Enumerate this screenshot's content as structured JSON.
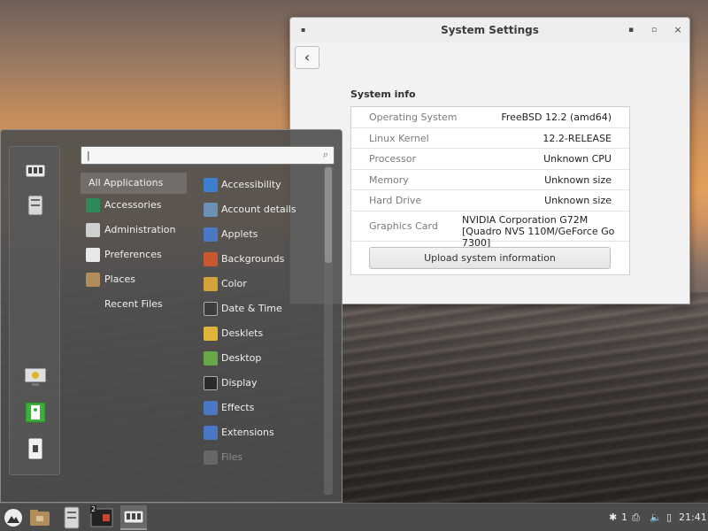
{
  "settings_window": {
    "title": "System Settings",
    "back_glyph": "‹",
    "min_glyph": "▪",
    "max_glyph": "▫",
    "close_glyph": "×",
    "menu_glyph": "▪",
    "section_title": "System info",
    "rows": [
      {
        "key": "Operating System",
        "value": "FreeBSD 12.2 (amd64)"
      },
      {
        "key": "Linux Kernel",
        "value": "12.2-RELEASE"
      },
      {
        "key": "Processor",
        "value": "Unknown CPU"
      },
      {
        "key": "Memory",
        "value": "Unknown size"
      },
      {
        "key": "Hard Drive",
        "value": "Unknown size"
      },
      {
        "key": "Graphics Card",
        "value": "NVIDIA Corporation G72M [Quadro NVS 110M/GeForce Go 7300]"
      }
    ],
    "upload_label": "Upload system information"
  },
  "menu": {
    "search": {
      "value": "|",
      "icon": "search-icon"
    },
    "categories": [
      {
        "label": "All Applications",
        "icon": "none",
        "selected": true
      },
      {
        "label": "Accessories",
        "icon": "accessories-icon"
      },
      {
        "label": "Administration",
        "icon": "administration-icon"
      },
      {
        "label": "Preferences",
        "icon": "preferences-icon"
      },
      {
        "label": "Places",
        "icon": "folder-icon"
      },
      {
        "label": "Recent Files",
        "icon": "none"
      }
    ],
    "apps": [
      {
        "label": "Accessibility",
        "icon": "accessibility-icon",
        "color": "#3a7fd0"
      },
      {
        "label": "Account details",
        "icon": "account-icon",
        "color": "#6d8fb5"
      },
      {
        "label": "Applets",
        "icon": "applets-icon",
        "color": "#4a78c4"
      },
      {
        "label": "Backgrounds",
        "icon": "backgrounds-icon",
        "color": "#c9562f"
      },
      {
        "label": "Color",
        "icon": "color-icon",
        "color": "#d4a23a"
      },
      {
        "label": "Date & Time",
        "icon": "clock-icon",
        "color": "#3d3d3d"
      },
      {
        "label": "Desklets",
        "icon": "desklets-icon",
        "color": "#e0b33a"
      },
      {
        "label": "Desktop",
        "icon": "desktop-icon",
        "color": "#6aa64a"
      },
      {
        "label": "Display",
        "icon": "display-icon",
        "color": "#2b2b2b"
      },
      {
        "label": "Effects",
        "icon": "effects-icon",
        "color": "#4a78c4"
      },
      {
        "label": "Extensions",
        "icon": "extensions-icon",
        "color": "#4a78c4"
      },
      {
        "label": "Files",
        "icon": "files-icon",
        "color": "#7a7a7a",
        "dim": true
      }
    ],
    "favorites": [
      "settings-icon",
      "file-manager-icon",
      "lock-screen-icon",
      "logout-icon",
      "shutdown-icon"
    ]
  },
  "panel": {
    "menu_icon": "cinnamon-menu-icon",
    "launchers": [
      "files-launcher-icon",
      "terminal-launcher-icon",
      "settings-launcher-icon"
    ],
    "terminal_badge": "2",
    "tray": {
      "notifications_count": "1",
      "clock": "21:41"
    }
  }
}
